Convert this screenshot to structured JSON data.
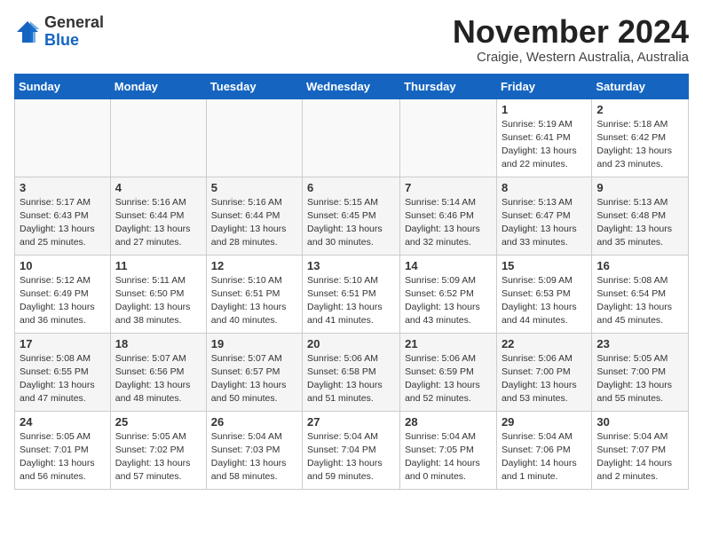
{
  "header": {
    "logo": {
      "general": "General",
      "blue": "Blue"
    },
    "title": "November 2024",
    "location": "Craigie, Western Australia, Australia"
  },
  "calendar": {
    "days_of_week": [
      "Sunday",
      "Monday",
      "Tuesday",
      "Wednesday",
      "Thursday",
      "Friday",
      "Saturday"
    ],
    "weeks": [
      [
        {
          "day": "",
          "info": ""
        },
        {
          "day": "",
          "info": ""
        },
        {
          "day": "",
          "info": ""
        },
        {
          "day": "",
          "info": ""
        },
        {
          "day": "",
          "info": ""
        },
        {
          "day": "1",
          "info": "Sunrise: 5:19 AM\nSunset: 6:41 PM\nDaylight: 13 hours\nand 22 minutes."
        },
        {
          "day": "2",
          "info": "Sunrise: 5:18 AM\nSunset: 6:42 PM\nDaylight: 13 hours\nand 23 minutes."
        }
      ],
      [
        {
          "day": "3",
          "info": "Sunrise: 5:17 AM\nSunset: 6:43 PM\nDaylight: 13 hours\nand 25 minutes."
        },
        {
          "day": "4",
          "info": "Sunrise: 5:16 AM\nSunset: 6:44 PM\nDaylight: 13 hours\nand 27 minutes."
        },
        {
          "day": "5",
          "info": "Sunrise: 5:16 AM\nSunset: 6:44 PM\nDaylight: 13 hours\nand 28 minutes."
        },
        {
          "day": "6",
          "info": "Sunrise: 5:15 AM\nSunset: 6:45 PM\nDaylight: 13 hours\nand 30 minutes."
        },
        {
          "day": "7",
          "info": "Sunrise: 5:14 AM\nSunset: 6:46 PM\nDaylight: 13 hours\nand 32 minutes."
        },
        {
          "day": "8",
          "info": "Sunrise: 5:13 AM\nSunset: 6:47 PM\nDaylight: 13 hours\nand 33 minutes."
        },
        {
          "day": "9",
          "info": "Sunrise: 5:13 AM\nSunset: 6:48 PM\nDaylight: 13 hours\nand 35 minutes."
        }
      ],
      [
        {
          "day": "10",
          "info": "Sunrise: 5:12 AM\nSunset: 6:49 PM\nDaylight: 13 hours\nand 36 minutes."
        },
        {
          "day": "11",
          "info": "Sunrise: 5:11 AM\nSunset: 6:50 PM\nDaylight: 13 hours\nand 38 minutes."
        },
        {
          "day": "12",
          "info": "Sunrise: 5:10 AM\nSunset: 6:51 PM\nDaylight: 13 hours\nand 40 minutes."
        },
        {
          "day": "13",
          "info": "Sunrise: 5:10 AM\nSunset: 6:51 PM\nDaylight: 13 hours\nand 41 minutes."
        },
        {
          "day": "14",
          "info": "Sunrise: 5:09 AM\nSunset: 6:52 PM\nDaylight: 13 hours\nand 43 minutes."
        },
        {
          "day": "15",
          "info": "Sunrise: 5:09 AM\nSunset: 6:53 PM\nDaylight: 13 hours\nand 44 minutes."
        },
        {
          "day": "16",
          "info": "Sunrise: 5:08 AM\nSunset: 6:54 PM\nDaylight: 13 hours\nand 45 minutes."
        }
      ],
      [
        {
          "day": "17",
          "info": "Sunrise: 5:08 AM\nSunset: 6:55 PM\nDaylight: 13 hours\nand 47 minutes."
        },
        {
          "day": "18",
          "info": "Sunrise: 5:07 AM\nSunset: 6:56 PM\nDaylight: 13 hours\nand 48 minutes."
        },
        {
          "day": "19",
          "info": "Sunrise: 5:07 AM\nSunset: 6:57 PM\nDaylight: 13 hours\nand 50 minutes."
        },
        {
          "day": "20",
          "info": "Sunrise: 5:06 AM\nSunset: 6:58 PM\nDaylight: 13 hours\nand 51 minutes."
        },
        {
          "day": "21",
          "info": "Sunrise: 5:06 AM\nSunset: 6:59 PM\nDaylight: 13 hours\nand 52 minutes."
        },
        {
          "day": "22",
          "info": "Sunrise: 5:06 AM\nSunset: 7:00 PM\nDaylight: 13 hours\nand 53 minutes."
        },
        {
          "day": "23",
          "info": "Sunrise: 5:05 AM\nSunset: 7:00 PM\nDaylight: 13 hours\nand 55 minutes."
        }
      ],
      [
        {
          "day": "24",
          "info": "Sunrise: 5:05 AM\nSunset: 7:01 PM\nDaylight: 13 hours\nand 56 minutes."
        },
        {
          "day": "25",
          "info": "Sunrise: 5:05 AM\nSunset: 7:02 PM\nDaylight: 13 hours\nand 57 minutes."
        },
        {
          "day": "26",
          "info": "Sunrise: 5:04 AM\nSunset: 7:03 PM\nDaylight: 13 hours\nand 58 minutes."
        },
        {
          "day": "27",
          "info": "Sunrise: 5:04 AM\nSunset: 7:04 PM\nDaylight: 13 hours\nand 59 minutes."
        },
        {
          "day": "28",
          "info": "Sunrise: 5:04 AM\nSunset: 7:05 PM\nDaylight: 14 hours\nand 0 minutes."
        },
        {
          "day": "29",
          "info": "Sunrise: 5:04 AM\nSunset: 7:06 PM\nDaylight: 14 hours\nand 1 minute."
        },
        {
          "day": "30",
          "info": "Sunrise: 5:04 AM\nSunset: 7:07 PM\nDaylight: 14 hours\nand 2 minutes."
        }
      ]
    ]
  }
}
